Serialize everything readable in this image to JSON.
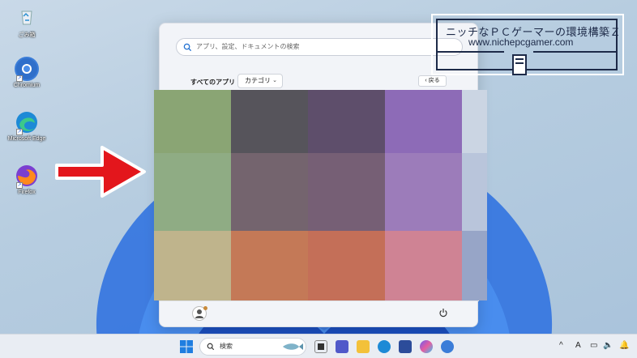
{
  "desktop": {
    "icons": [
      {
        "label": "ごみ箱",
        "icon": "recycle-bin-icon"
      },
      {
        "label": "Chromium",
        "icon": "chromium-icon"
      },
      {
        "label": "Microsoft Edge",
        "icon": "edge-icon"
      },
      {
        "label": "Firefox",
        "icon": "firefox-icon"
      }
    ]
  },
  "start_menu": {
    "search_placeholder": "アプリ、設定、ドキュメントの検索",
    "all_apps_label": "すべてのアプリ",
    "category_label": "カテゴリ",
    "back_label": "戻る"
  },
  "watermark": {
    "title": "ニッチなＰＣゲーマーの環境構築Ｚ",
    "url": "www.nichepcgamer.com"
  },
  "mosaic": [
    [
      "#8aa574",
      "#56545b",
      "#5e4e6b",
      "#8d6bb7",
      "#cbd5e3"
    ],
    [
      "#8fac84",
      "#74646e",
      "#765f75",
      "#9c7cba",
      "#b9c5db"
    ],
    [
      "#bfb48c",
      "#c47957",
      "#c46f58",
      "#cf8394",
      "#97a5c7"
    ]
  ],
  "taskbar": {
    "search_label": "検索",
    "apps": [
      "file-icon",
      "teams-icon",
      "explorer-icon",
      "edge-icon",
      "store-icon",
      "copilot-icon",
      "chromium-icon"
    ],
    "tray": {
      "ime": "A"
    }
  }
}
